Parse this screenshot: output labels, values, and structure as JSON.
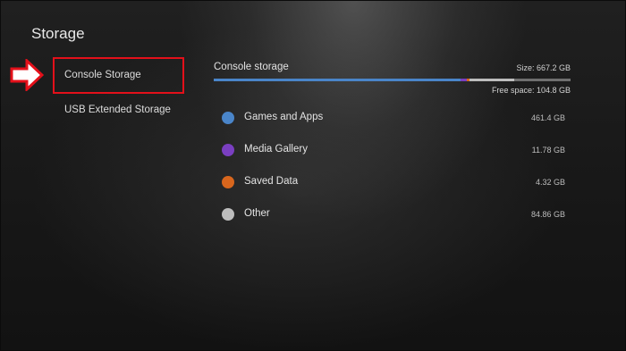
{
  "page": {
    "title": "Storage"
  },
  "sidebar": {
    "items": [
      {
        "label": "Console Storage",
        "selected": true
      },
      {
        "label": "USB Extended Storage",
        "selected": false
      }
    ]
  },
  "annotation": {
    "highlight_color": "#e3101a",
    "arrow_icon": "red-right-arrow-icon"
  },
  "console_storage": {
    "title": "Console storage",
    "size_text": "Size: 667.2 GB",
    "free_space_text": "Free space: 104.8 GB",
    "bar": {
      "track_color": "#6f6f6f",
      "segments": [
        {
          "fraction": 0.6915,
          "color": "#4a85c9"
        },
        {
          "fraction": 0.0177,
          "color": "#7a3fc1"
        },
        {
          "fraction": 0.0065,
          "color": "#d8661d"
        },
        {
          "fraction": 0.1272,
          "color": "#bdbdbd"
        }
      ]
    },
    "categories": [
      {
        "label": "Games and Apps",
        "size": "461.4 GB",
        "color": "#4a85c9"
      },
      {
        "label": "Media Gallery",
        "size": "11.78 GB",
        "color": "#7a3fc1"
      },
      {
        "label": "Saved Data",
        "size": "4.32 GB",
        "color": "#d8661d"
      },
      {
        "label": "Other",
        "size": "84.86 GB",
        "color": "#bdbdbd"
      }
    ]
  }
}
